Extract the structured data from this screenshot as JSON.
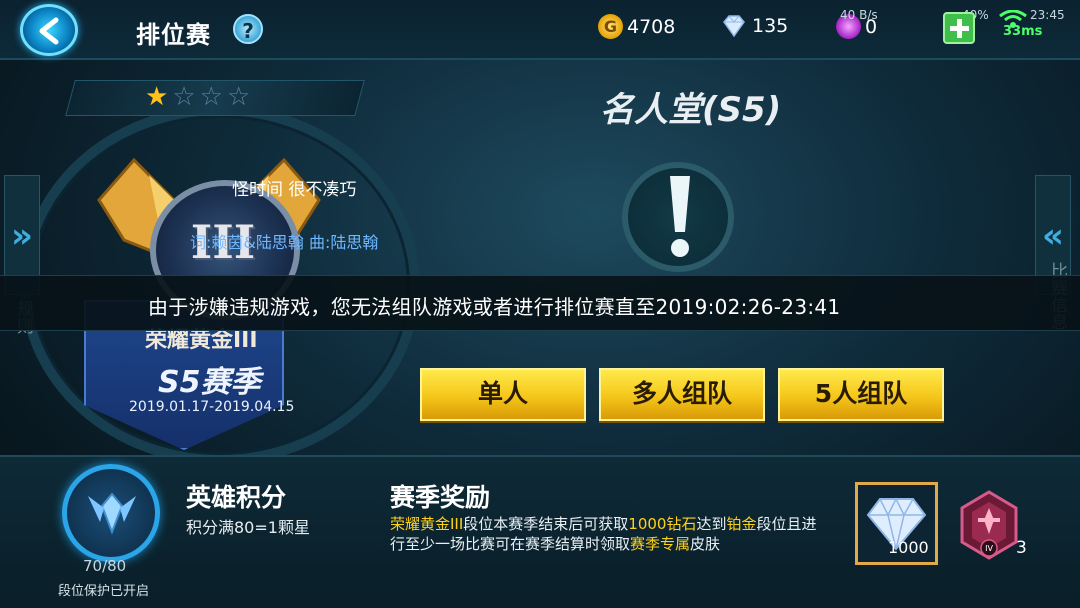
{
  "header": {
    "title": "排位赛",
    "help_label": "?",
    "gold": "4708",
    "diamonds": "135",
    "tickets": "0",
    "status_net": "40 B/s",
    "status_battery": "40%",
    "status_time": "23:45",
    "ping": "33ms"
  },
  "rank": {
    "stars_filled": 1,
    "stars_total": 4,
    "roman": "III",
    "name": "荣耀黄金III",
    "season": "S5赛季",
    "dates": "2019.01.17-2019.04.15"
  },
  "song": {
    "title": "怪时间 很不凑巧",
    "credit": "词:赖茵&陆思翰 曲:陆思翰"
  },
  "right_panel": {
    "hall_title": "名人堂(S5)",
    "side_left_text": "规则",
    "side_right_text": "比赛信息"
  },
  "banner": {
    "text": "由于涉嫌违规游戏，您无法组队游戏或者进行排位赛直至2019:02:26-23:41"
  },
  "modes": [
    "单人",
    "多人组队",
    "5人组队"
  ],
  "hero_score": {
    "title": "英雄积分",
    "subtitle": "积分满80=1颗星",
    "progress": "70/80",
    "protect": "段位保护已开启"
  },
  "season_reward": {
    "title": "赛季奖励",
    "desc_1": "荣耀黄金III",
    "desc_2": "段位本赛季结束后可获取",
    "desc_3": "1000钻石",
    "desc_4": "达到",
    "desc_5": "铂金",
    "desc_6": "段位且进行至少一场比赛可在赛季结算时领取",
    "desc_7": "赛季专属",
    "desc_8": "皮肤",
    "diamond_count": "1000",
    "skin_count": "3",
    "skin_level": "IV"
  },
  "colors": {
    "accent_yellow": "#ffd21a",
    "button_gold": "#f5c61a",
    "link_blue": "#6fb8ff"
  }
}
